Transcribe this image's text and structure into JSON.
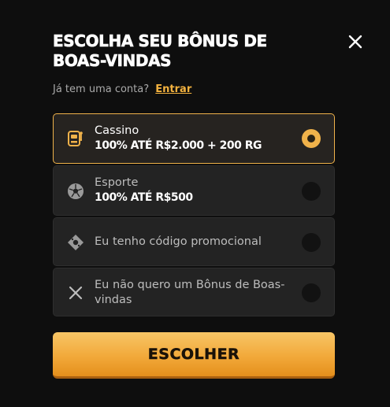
{
  "modal": {
    "title": "ESCOLHA SEU BÔNUS DE BOAS-VINDAS",
    "close_icon": "close-icon"
  },
  "login": {
    "prompt": "Já tem uma conta?",
    "link": "Entrar"
  },
  "options": [
    {
      "icon": "slot-machine-icon",
      "label": "Cassino",
      "sub": "100% ATÉ R$2.000 + 200 RG",
      "selected": true
    },
    {
      "icon": "soccer-ball-icon",
      "label": "Esporte",
      "sub": "100% ATÉ R$500",
      "selected": false
    },
    {
      "icon": "promo-code-icon",
      "label": "Eu tenho código promocional",
      "sub": "",
      "selected": false
    },
    {
      "icon": "x-icon",
      "label": "Eu não quero um Bônus de Boas-vindas",
      "sub": "",
      "selected": false
    }
  ],
  "submit": {
    "label": "ESCOLHER"
  },
  "colors": {
    "accent": "#f0b24a",
    "background": "#0e0e0e",
    "card": "#232323"
  }
}
